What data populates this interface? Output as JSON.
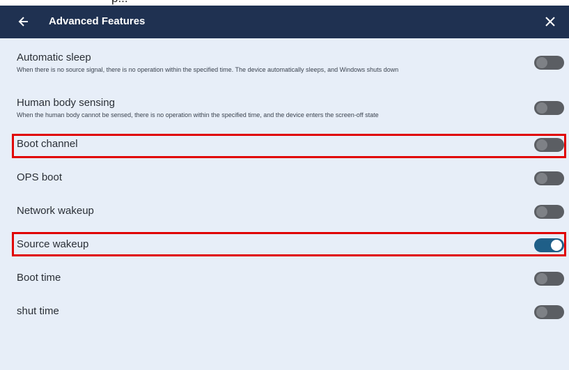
{
  "caption_fragment": "p...",
  "header": {
    "back_icon": "arrow-left-icon",
    "title": "Advanced Features",
    "close_icon": "close-x-icon"
  },
  "settings": [
    {
      "label": "Automatic sleep",
      "description": "When there is no source signal, there is no operation within the specified time. The device automatically sleeps, and Windows shuts down",
      "enabled": false
    },
    {
      "label": "Human body sensing",
      "description": "When the human body cannot be sensed, there is no operation within the specified time, and the device enters the screen-off state",
      "enabled": false
    },
    {
      "label": "Boot channel",
      "enabled": false,
      "highlighted": true
    },
    {
      "label": "OPS boot",
      "enabled": false
    },
    {
      "label": "Network wakeup",
      "enabled": false
    },
    {
      "label": "Source wakeup",
      "enabled": true,
      "highlighted": true
    },
    {
      "label": "Boot time",
      "enabled": false
    },
    {
      "label": "shut time",
      "enabled": false
    }
  ],
  "colors": {
    "header_bg": "#1f3151",
    "panel_bg": "#e7eef8",
    "toggle_on": "#1f5f88",
    "toggle_off": "#5b5e63",
    "highlight": "#e00000"
  }
}
